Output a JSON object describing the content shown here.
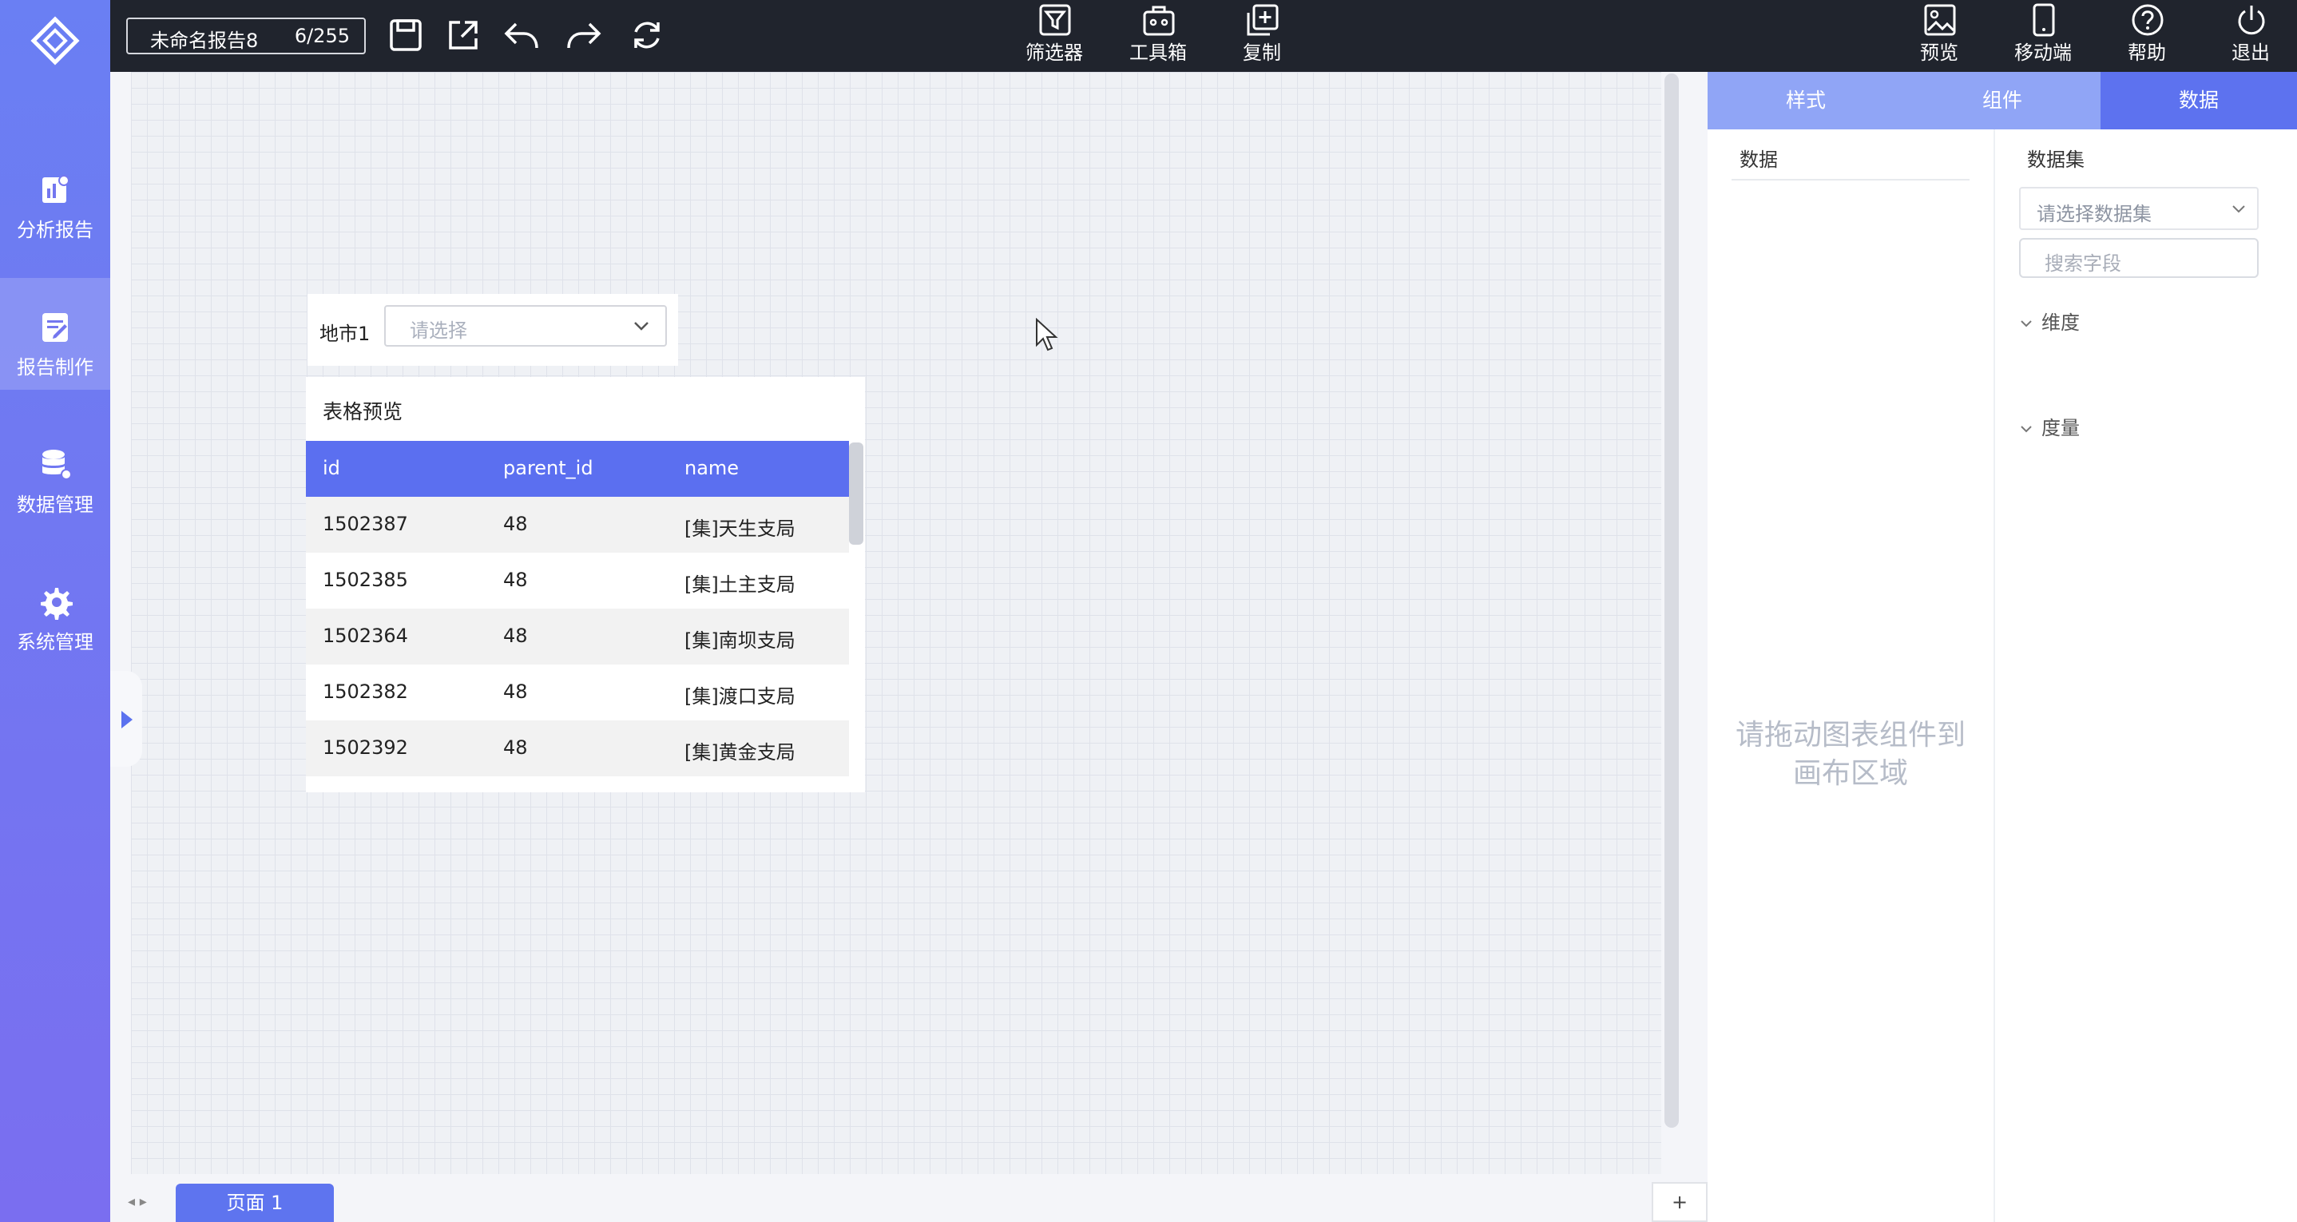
{
  "sidebar": {
    "items": [
      {
        "label": "分析报告",
        "icon": "chart-report-icon"
      },
      {
        "label": "报告制作",
        "icon": "document-edit-icon",
        "active": true
      },
      {
        "label": "数据管理",
        "icon": "database-icon"
      },
      {
        "label": "系统管理",
        "icon": "gear-icon"
      }
    ]
  },
  "toolbar": {
    "report_name": "未命名报告8",
    "name_count": "6/255",
    "center_tools": [
      {
        "label": "筛选器",
        "icon": "filter-icon"
      },
      {
        "label": "工具箱",
        "icon": "toolbox-icon"
      },
      {
        "label": "复制",
        "icon": "copy-plus-icon"
      }
    ],
    "right_tools": [
      {
        "label": "预览",
        "icon": "image-preview-icon"
      },
      {
        "label": "移动端",
        "icon": "mobile-icon"
      },
      {
        "label": "帮助",
        "icon": "help-icon"
      },
      {
        "label": "退出",
        "icon": "power-icon"
      }
    ]
  },
  "canvas": {
    "filter": {
      "label": "地市1",
      "placeholder": "请选择"
    },
    "table": {
      "title": "表格预览",
      "columns": [
        "id",
        "parent_id",
        "name"
      ],
      "rows": [
        [
          "1502387",
          "48",
          "[集]天生支局"
        ],
        [
          "1502385",
          "48",
          "[集]土主支局"
        ],
        [
          "1502364",
          "48",
          "[集]南坝支局"
        ],
        [
          "1502382",
          "48",
          "[集]渡口支局"
        ],
        [
          "1502392",
          "48",
          "[集]黄金支局"
        ]
      ]
    }
  },
  "pages": {
    "tabs": [
      "页面 1"
    ],
    "add_label": "+",
    "arrows": "◂ ▸"
  },
  "right_panel": {
    "tabs": [
      "样式",
      "组件",
      "数据"
    ],
    "active_tab": "数据",
    "data_header": "数据",
    "drop_hint_line1": "请拖动图表组件到",
    "drop_hint_line2": "画布区域",
    "dataset_header": "数据集",
    "dataset_placeholder": "请选择数据集",
    "search_placeholder": "搜索字段",
    "dimension_label": "维度",
    "measure_label": "度量"
  },
  "colors": {
    "accent": "#5b6ff0",
    "sidebar_top": "#6a7ff3",
    "topbar": "#20242d",
    "tab_inactive": "#90a5f6"
  }
}
